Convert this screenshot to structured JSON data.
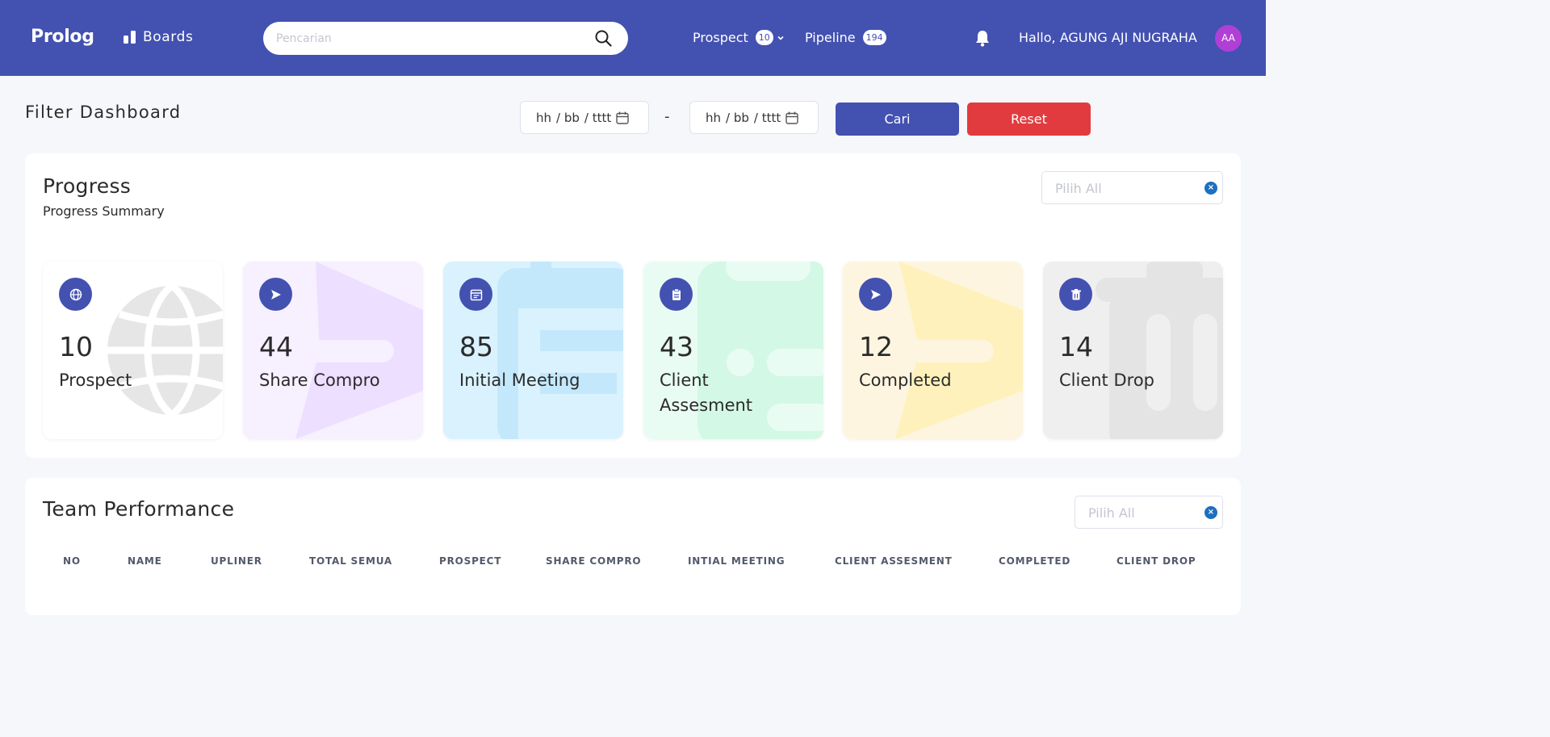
{
  "header": {
    "logo": "Prolog",
    "boards_label": "Boards",
    "search_placeholder": "Pencarian",
    "prospect_label": "Prospect",
    "prospect_count": "10",
    "pipeline_label": "Pipeline",
    "pipeline_count": "194",
    "greeting": "Hallo, AGUNG AJI NUGRAHA",
    "avatar_initials": "AA",
    "bar_color": "#4351b1"
  },
  "filter": {
    "title": "Filter Dashboard",
    "start_date": {
      "dd": "hh",
      "mm": "bb",
      "yyyy": "tttt"
    },
    "separator": "-",
    "end_date": {
      "dd": "hh",
      "mm": "bb",
      "yyyy": "tttt"
    },
    "search_button": "Cari",
    "reset_button": "Reset"
  },
  "progress": {
    "title": "Progress",
    "subtitle": "Progress Summary",
    "select_value": "Pilih All",
    "clear_symbol": "×",
    "cards": [
      {
        "value": "10",
        "label": "Prospect",
        "icon": "globe-icon",
        "bg": "#ffffff"
      },
      {
        "value": "44",
        "label": "Share Compro",
        "icon": "send-icon",
        "bg": "#f6efff"
      },
      {
        "value": "85",
        "label": "Initial Meeting",
        "icon": "calendar-icon",
        "bg": "#d8f1fe"
      },
      {
        "value": "43",
        "label": "Client Assesment",
        "icon": "clipboard-icon",
        "bg": "#e6fbf1"
      },
      {
        "value": "12",
        "label": "Completed",
        "icon": "send-icon",
        "bg": "#fef6e0"
      },
      {
        "value": "14",
        "label": "Client Drop",
        "icon": "trash-icon",
        "bg": "#f0f0f0"
      }
    ]
  },
  "team": {
    "title": "Team Performance",
    "select_value": "Pilih All",
    "clear_symbol": "×",
    "columns": [
      "NO",
      "NAME",
      "UPLINER",
      "TOTAL SEMUA",
      "PROSPECT",
      "SHARE COMPRO",
      "INTIAL MEETING",
      "CLIENT ASSESMENT",
      "COMPLETED",
      "CLIENT DROP"
    ]
  }
}
